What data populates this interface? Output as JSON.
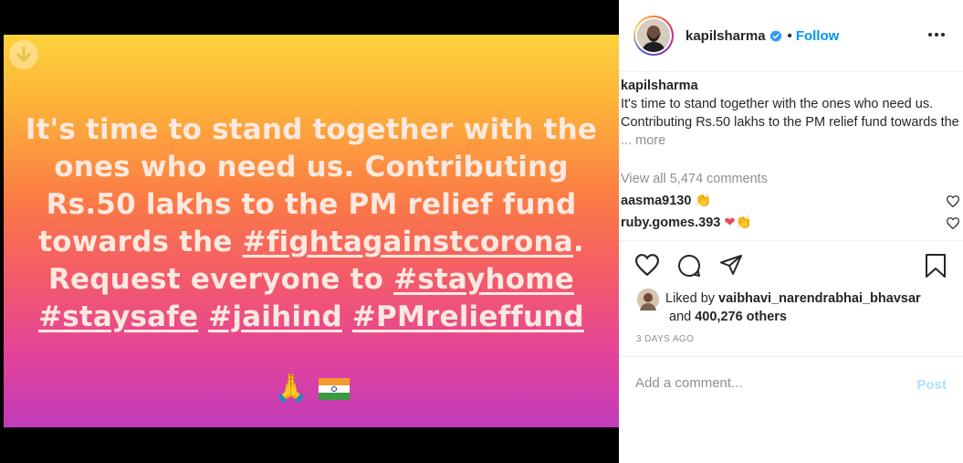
{
  "post": {
    "image_text": {
      "line1": "It's time to stand together with the",
      "line2": "ones who need us. Contributing",
      "line3": "Rs.50 lakhs to the PM relief fund",
      "line4_pre": "towards the ",
      "tag_fightagainstcorona": "#fightagainstcorona",
      "line4_post": ".",
      "line5_pre": "Request everyone to ",
      "tag_stayhome": "#stayhome",
      "tag_staysafe": "#staysafe",
      "tag_jaihind": "#jaihind",
      "tag_pmrelieffund": "#PMrelieffund",
      "emoji_folded_hands": "🙏",
      "emoji_flag": "🇮🇳"
    },
    "download_icon": "arrow-down-icon"
  },
  "header": {
    "username": "kapilsharma",
    "separator": "•",
    "follow_label": "Follow",
    "verified_icon": "verified-badge-icon",
    "more_icon": "more-horizontal-icon"
  },
  "caption": {
    "username": "kapilsharma",
    "text": "It's time to stand together with the ones who need us. Contributing Rs.50 lakhs to the PM relief fund towards the",
    "more": "... more"
  },
  "comments": {
    "view_all": "View all 5,474 comments",
    "items": [
      {
        "user": "aasma9130",
        "emojis": "👏"
      },
      {
        "user": "ruby.gomes.393",
        "emojis": "❤👏"
      }
    ]
  },
  "likes": {
    "prefix": "Liked by ",
    "liker": "vaibhavi_narendrabhai_bhavsar",
    "and": "and ",
    "others": "400,276 others"
  },
  "date": "3 DAYS AGO",
  "comment_box": {
    "placeholder": "Add a comment...",
    "post_label": "Post"
  },
  "colors": {
    "accent": "#0095f6",
    "post_disabled": "#b2dffc",
    "text": "#262626",
    "muted": "#8e8e8e",
    "heart_red": "#ed4956"
  }
}
